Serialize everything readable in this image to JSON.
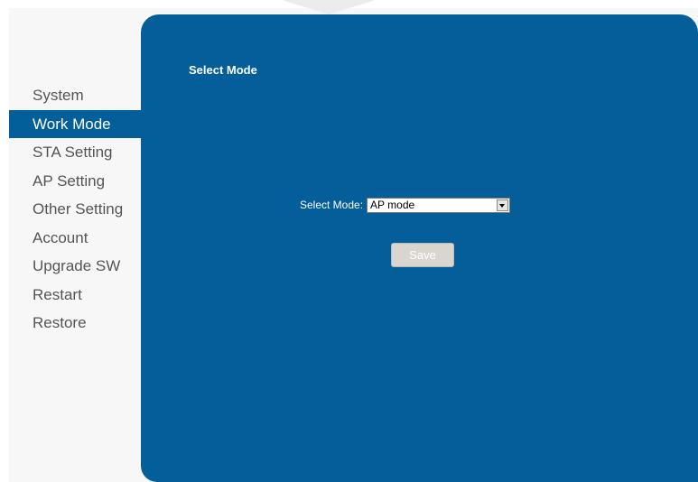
{
  "sidebar": {
    "items": [
      {
        "label": "System",
        "active": false
      },
      {
        "label": "Work Mode",
        "active": true
      },
      {
        "label": "STA Setting",
        "active": false
      },
      {
        "label": "AP Setting",
        "active": false
      },
      {
        "label": "Other Setting",
        "active": false
      },
      {
        "label": "Account",
        "active": false
      },
      {
        "label": "Upgrade SW",
        "active": false
      },
      {
        "label": "Restart",
        "active": false
      },
      {
        "label": "Restore",
        "active": false
      }
    ]
  },
  "main": {
    "title": "Select Mode",
    "select_mode": {
      "label": "Select Mode:",
      "value": "AP mode"
    },
    "save_label": "Save"
  },
  "colors": {
    "panel_bg": "#035e9a",
    "active_item_bg": "#035e9a",
    "sidebar_text": "#555555",
    "page_bg": "#f7f7f7",
    "save_button_bg": "#d9d6d0"
  }
}
